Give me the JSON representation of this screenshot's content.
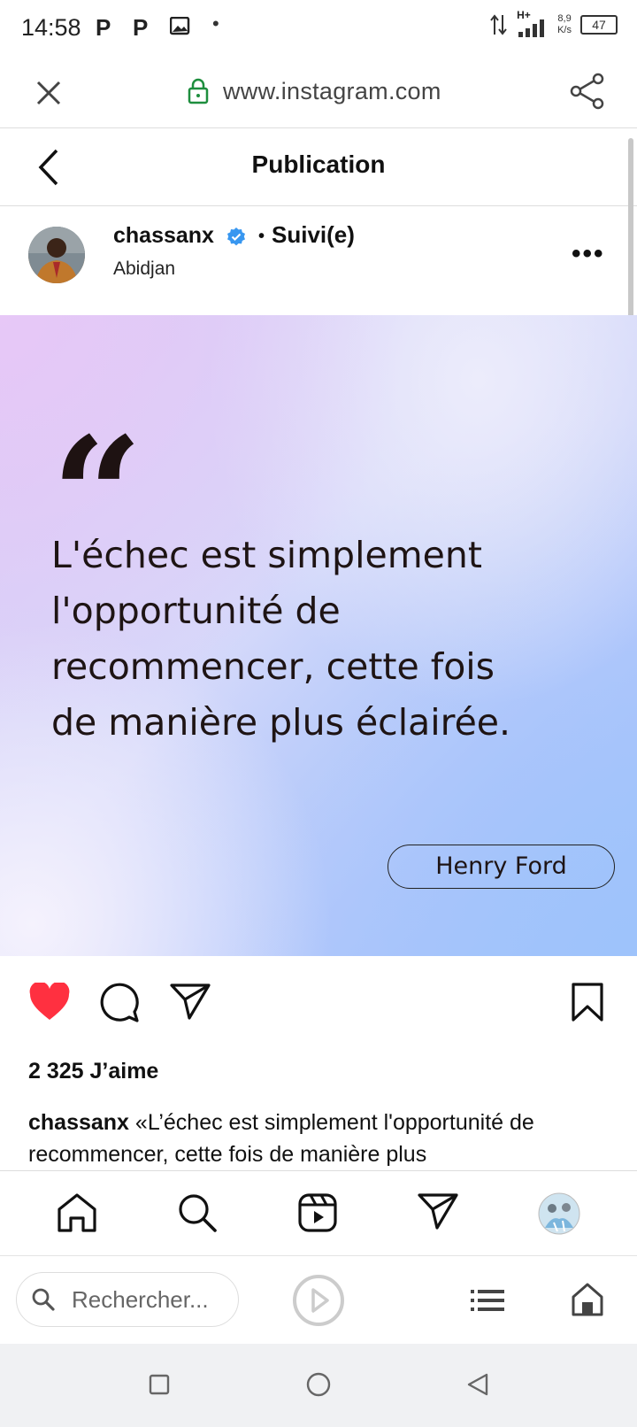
{
  "status_bar": {
    "time": "14:58",
    "notifications": [
      "P",
      "P",
      "gallery-icon",
      "•"
    ],
    "network_type": "H+",
    "speed_value": "8,9",
    "speed_unit": "K/s",
    "battery": "47"
  },
  "browser": {
    "url": "www.instagram.com",
    "search_placeholder": "Rechercher..."
  },
  "header": {
    "title": "Publication"
  },
  "post": {
    "username": "chassanx",
    "follow_status": "Suivi(e)",
    "separator": "•",
    "location": "Abidjan",
    "quote_mark": "“",
    "quote_lines": [
      "L'échec est simplement",
      "l'opportunité de",
      "recommencer, cette fois",
      "de manière plus éclairée."
    ],
    "author": "Henry Ford",
    "likes": "2 325 J’aime",
    "caption_user": "chassanx",
    "caption_text": " «L’échec est simplement l'opportunité de recommencer, cette fois de manière plus"
  },
  "colors": {
    "like_red": "#ff3040",
    "verified_blue": "#3897f0",
    "lock_green": "#1e8e3e"
  },
  "icons": {
    "close": "close-icon",
    "lock": "lock-icon",
    "share": "share-icon",
    "back": "chevron-left-icon",
    "more": "more-icon",
    "like": "heart-icon",
    "comment": "comment-icon",
    "send": "send-icon",
    "save": "bookmark-icon",
    "home": "home-icon",
    "search": "search-icon",
    "reels": "reels-icon",
    "direct": "direct-icon",
    "profile": "profile-avatar"
  }
}
